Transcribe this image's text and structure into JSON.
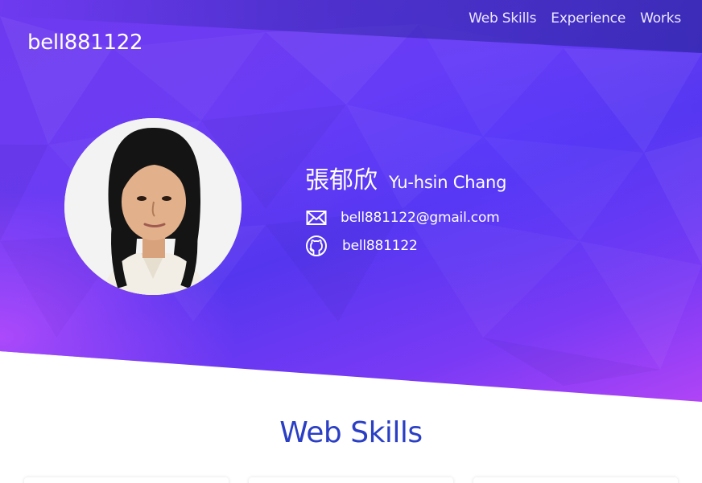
{
  "header": {
    "brand": "bell881122",
    "nav": [
      {
        "label": "Web Skills"
      },
      {
        "label": "Experience"
      },
      {
        "label": "Works"
      }
    ]
  },
  "profile": {
    "name_cn": "張郁欣",
    "name_en": "Yu-hsin Chang",
    "email": "bell881122@gmail.com",
    "github": "bell881122",
    "avatar_icon": "profile-photo",
    "email_icon": "envelope-icon",
    "github_icon": "github-icon"
  },
  "sections": {
    "web_skills_title": "Web Skills"
  },
  "colors": {
    "hero_start": "#6f3af0",
    "hero_end": "#b044f6",
    "title_blue": "#2a3fc4",
    "text_white": "#ffffff"
  }
}
